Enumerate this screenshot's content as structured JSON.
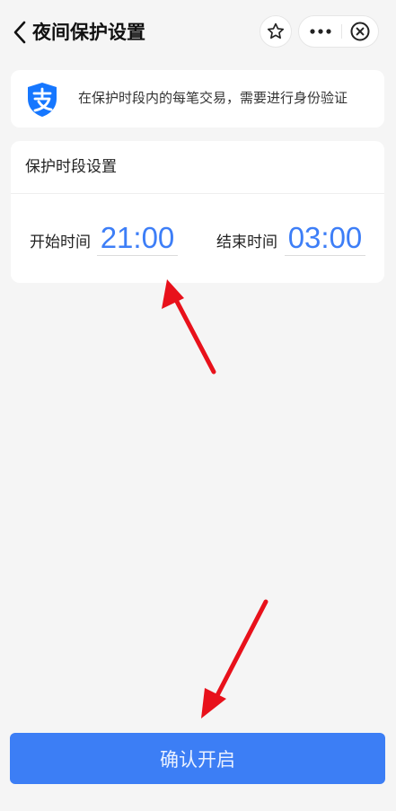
{
  "nav": {
    "title": "夜间保护设置",
    "back_icon": "chevron-left-icon",
    "favorite_icon": "star-outline-icon",
    "more_icon": "more-dots-icon",
    "close_icon": "close-circle-icon"
  },
  "notice": {
    "icon": "alipay-shield-icon",
    "icon_color": "#1677ff",
    "text": "在保护时段内的每笔交易，需要进行身份验证"
  },
  "period": {
    "title": "保护时段设置",
    "start_label": "开始时间",
    "start_value": "21:00",
    "end_label": "结束时间",
    "end_value": "03:00",
    "value_color": "#3d7ef7"
  },
  "confirm_button": {
    "label": "确认开启",
    "color": "#3c7ef5"
  },
  "annotations": {
    "arrow_color": "#e8111b"
  }
}
